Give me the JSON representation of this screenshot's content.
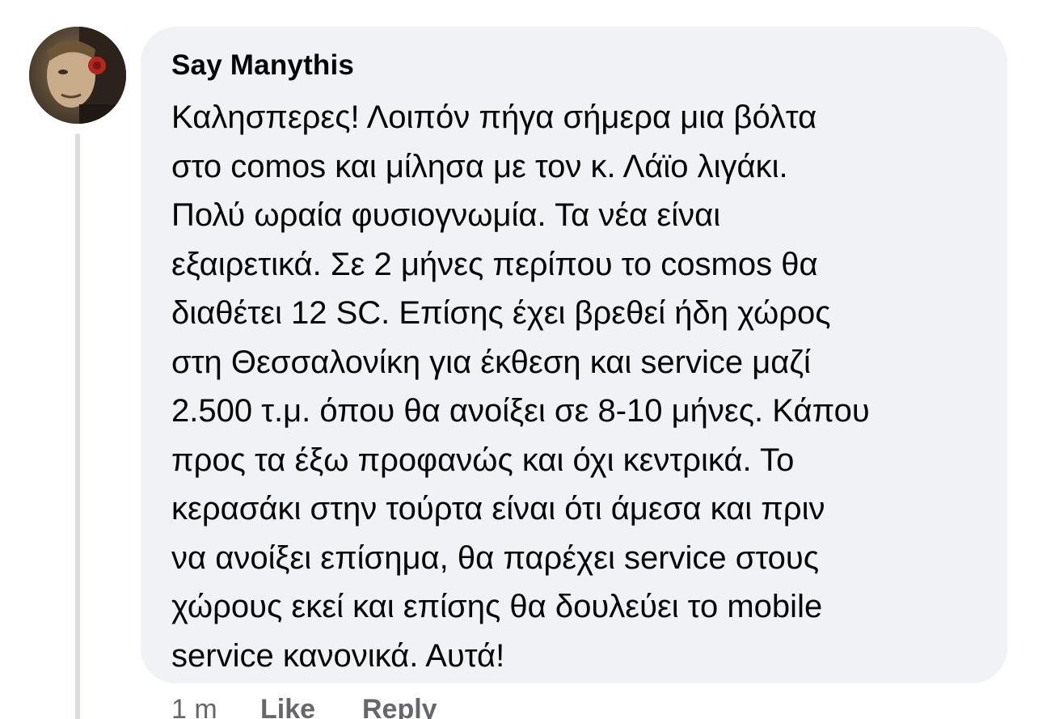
{
  "comment": {
    "author": "Say Manythis",
    "lines": [
      "Καλησπερες! Λοιπόν πήγα σήμερα μια βόλτα",
      "στο comos και μίλησα με τον κ. Λάϊο λιγάκι.",
      "Πολύ ωραία φυσιογνωμία. Τα νέα είναι",
      "εξαιρετικά. Σε 2 μήνες περίπου το cosmos θα",
      "διαθέτει 12 SC. Επίσης έχει βρεθεί ήδη χώρος",
      "στη Θεσσαλονίκη για έκθεση και service μαζί",
      "2.500 τ.μ. όπου θα ανοίξει σε 8-10 μήνες. Κάπου",
      "προς τα έξω προφανώς και όχι κεντρικά. Το",
      "κερασάκι στην τούρτα είναι ότι άμεσα και πριν",
      "να ανοίξει επίσημα, θα παρέχει service στους",
      "χώρους εκεί και επίσης θα δουλεύει το mobile",
      "service κανονικά. Αυτά!"
    ],
    "time": "1 m",
    "like_label": "Like",
    "reply_label": "Reply"
  },
  "colors": {
    "bubble_bg": "#f0f2f5",
    "text": "#050505",
    "meta": "#65676b",
    "thread_line": "#dcdde1"
  }
}
